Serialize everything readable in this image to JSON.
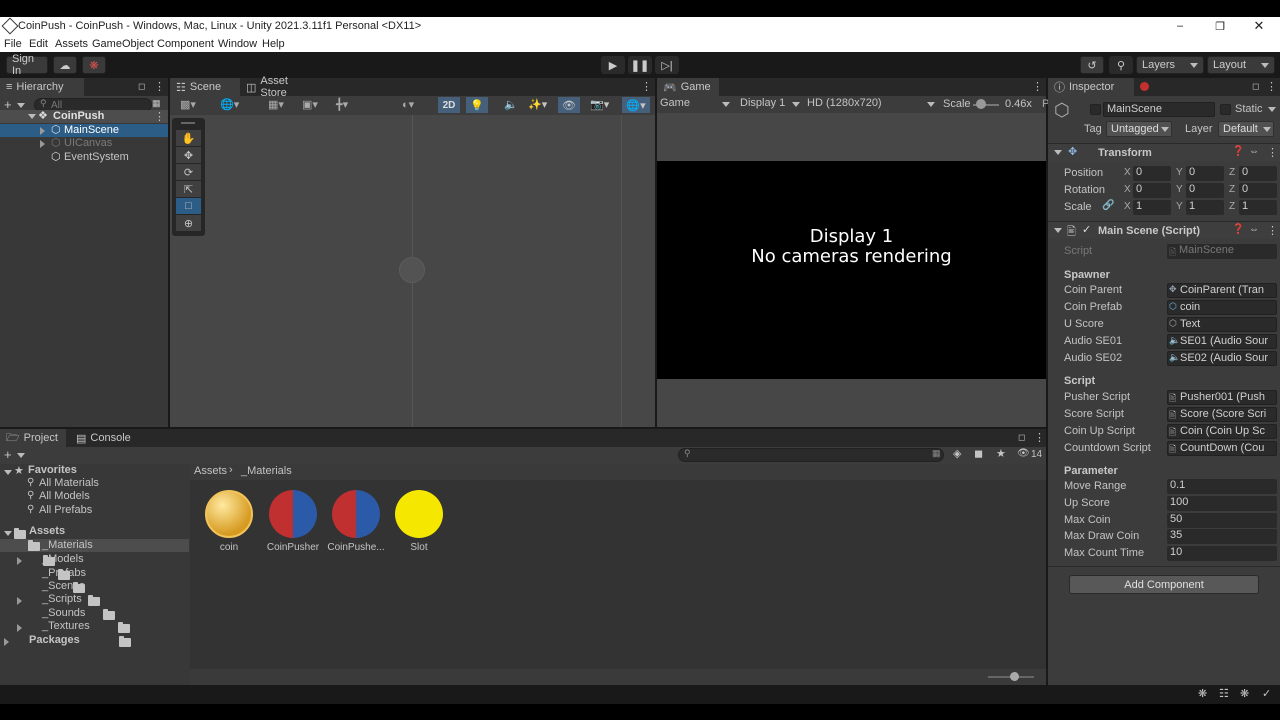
{
  "window": {
    "title": "CoinPush - CoinPush - Windows, Mac, Linux - Unity 2021.3.11f1 Personal <DX11>"
  },
  "menu": [
    "File",
    "Edit",
    "Assets",
    "GameObject",
    "Component",
    "Window",
    "Help"
  ],
  "toolbar": {
    "sign_in": "Sign In",
    "layers": "Layers",
    "layout": "Layout"
  },
  "hierarchy": {
    "tab": "Hierarchy",
    "search_placeholder": "All",
    "root": "CoinPush",
    "items": [
      "MainScene",
      "UICanvas",
      "EventSystem"
    ]
  },
  "scene": {
    "tab": "Scene",
    "asset_store_tab": "Asset Store",
    "mode_2d": "2D"
  },
  "game": {
    "tab": "Game",
    "view_select": "Game",
    "display_select": "Display 1",
    "resolution_select": "HD (1280x720)",
    "scale_label": "Scale",
    "scale_value": "0.46x",
    "message_line1": "Display 1",
    "message_line2": "No cameras rendering"
  },
  "inspector": {
    "tab": "Inspector",
    "object_name": "MainScene",
    "static_label": "Static",
    "tag_label": "Tag",
    "tag_value": "Untagged",
    "layer_label": "Layer",
    "layer_value": "Default",
    "transform": {
      "title": "Transform",
      "position_label": "Position",
      "rotation_label": "Rotation",
      "scale_label": "Scale",
      "position": [
        "0",
        "0",
        "0"
      ],
      "rotation": [
        "0",
        "0",
        "0"
      ],
      "scale": [
        "1",
        "1",
        "1"
      ],
      "axes": [
        "X",
        "Y",
        "Z"
      ]
    },
    "main_scene": {
      "title": "Main Scene (Script)",
      "script_label": "Script",
      "script_value": "MainScene",
      "sections": [
        {
          "header": "Spawner",
          "rows": [
            {
              "label": "Coin Parent",
              "value": "CoinParent (Tran"
            },
            {
              "label": "Coin Prefab",
              "value": "coin"
            },
            {
              "label": "U Score",
              "value": "Text"
            },
            {
              "label": "Audio SE01",
              "value": "SE01 (Audio Sour"
            },
            {
              "label": "Audio SE02",
              "value": "SE02 (Audio Sour"
            }
          ]
        },
        {
          "header": "Script",
          "rows": [
            {
              "label": "Pusher Script",
              "value": "Pusher001 (Push"
            },
            {
              "label": "Score Script",
              "value": "Score (Score Scri"
            },
            {
              "label": "Coin Up Script",
              "value": "Coin (Coin Up Sc"
            },
            {
              "label": "Countdown Script",
              "value": "CountDown (Cou"
            }
          ]
        },
        {
          "header": "Parameter",
          "rows": [
            {
              "label": "Move Range",
              "value": "0.1"
            },
            {
              "label": "Up Score",
              "value": "100"
            },
            {
              "label": "Max Coin",
              "value": "50"
            },
            {
              "label": "Max Draw Coin",
              "value": "35"
            },
            {
              "label": "Max Count Time",
              "value": "10"
            }
          ]
        }
      ]
    },
    "add_component": "Add Component"
  },
  "project": {
    "tab": "Project",
    "console_tab": "Console",
    "hidden_count": "14",
    "favorites_label": "Favorites",
    "favorites": [
      "All Materials",
      "All Models",
      "All Prefabs"
    ],
    "assets_label": "Assets",
    "folders": [
      "_Materials",
      "_Models",
      "_Prefabs",
      "_Scenes",
      "_Scripts",
      "_Sounds",
      "_Textures"
    ],
    "packages_label": "Packages",
    "breadcrumb_root": "Assets",
    "breadcrumb_current": "_Materials",
    "thumbnails": [
      "coin",
      "CoinPusher",
      "CoinPushe...",
      "Slot"
    ]
  },
  "colors": {
    "accent_selection": "#2c5d87",
    "yellow_coin": "#f5e700",
    "dark_bg": "#191919",
    "panel_bg": "#383838"
  }
}
